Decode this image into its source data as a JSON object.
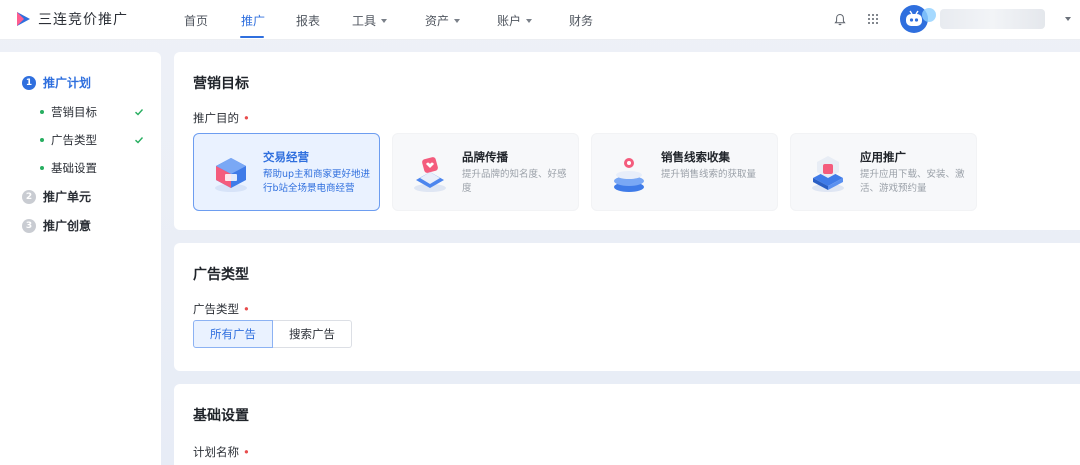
{
  "app": {
    "logo_text": "三连竞价推广"
  },
  "nav": {
    "items": [
      {
        "label": "首页",
        "active": false,
        "dropdown": false
      },
      {
        "label": "推广",
        "active": true,
        "dropdown": false
      },
      {
        "label": "报表",
        "active": false,
        "dropdown": false
      },
      {
        "label": "工具",
        "active": false,
        "dropdown": true
      },
      {
        "label": "资产",
        "active": false,
        "dropdown": true
      },
      {
        "label": "账户",
        "active": false,
        "dropdown": true
      },
      {
        "label": "财务",
        "active": false,
        "dropdown": false
      }
    ],
    "icons": [
      "bell-icon",
      "apps-grid-icon"
    ]
  },
  "sidebar": {
    "steps": [
      {
        "num": "1",
        "label": "推广计划",
        "active": true
      },
      {
        "num": "2",
        "label": "推广单元",
        "active": false
      },
      {
        "num": "3",
        "label": "推广创意",
        "active": false
      }
    ],
    "substeps": [
      {
        "label": "营销目标",
        "done": true
      },
      {
        "label": "广告类型",
        "done": true
      },
      {
        "label": "基础设置",
        "done": false
      }
    ]
  },
  "marketing": {
    "title": "营销目标",
    "field_label": "推广目的",
    "required_mark": "•",
    "options": [
      {
        "title": "交易经营",
        "desc": "帮助up主和商家更好地进行b站全场景电商经营",
        "selected": true,
        "icon": "shop-box-icon"
      },
      {
        "title": "品牌传播",
        "desc": "提升品牌的知名度、好感度",
        "selected": false,
        "icon": "brand-heart-icon"
      },
      {
        "title": "销售线索收集",
        "desc": "提升销售线索的获取量",
        "selected": false,
        "icon": "leads-stack-icon"
      },
      {
        "title": "应用推广",
        "desc": "提升应用下载、安装、激活、游戏预约量",
        "selected": false,
        "icon": "app-gift-icon"
      }
    ]
  },
  "adtype": {
    "title": "广告类型",
    "field_label": "广告类型",
    "required_mark": "•",
    "options": [
      {
        "label": "所有广告",
        "selected": true
      },
      {
        "label": "搜索广告",
        "selected": false
      }
    ]
  },
  "basic": {
    "title": "基础设置",
    "field_label": "计划名称",
    "required_mark": "•"
  },
  "colors": {
    "accent": "#2f6fde",
    "selected_bg": "#eaf2ff",
    "required": "#e84c4c",
    "done": "#27ae60"
  }
}
